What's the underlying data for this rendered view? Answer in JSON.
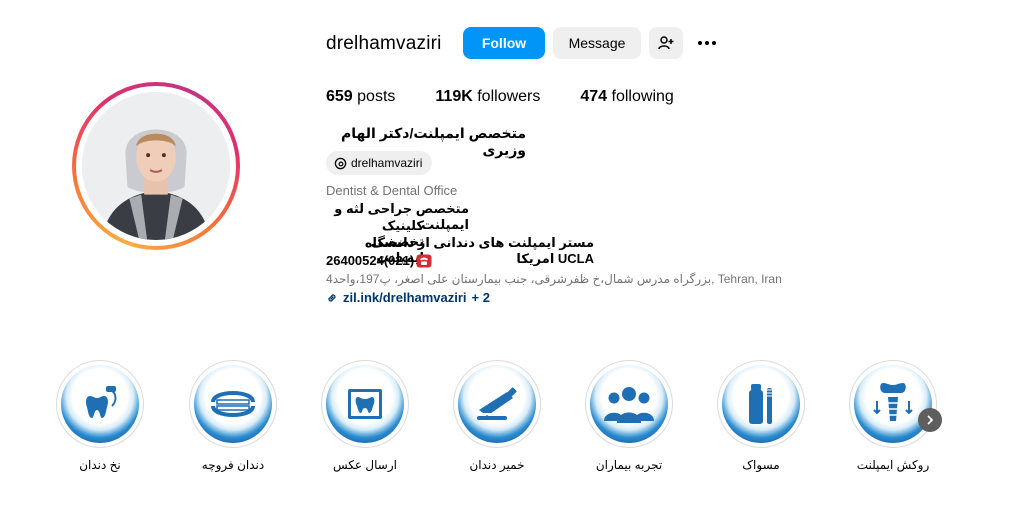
{
  "profile": {
    "username": "drelhamvaziri",
    "follow_label": "Follow",
    "message_label": "Message",
    "posts_count": "659",
    "posts_label": "posts",
    "followers_count": "119K",
    "followers_label": "followers",
    "following_count": "474",
    "following_label": "following",
    "full_name": "متخصص ایمپلنت/دکتر الهام وزیری",
    "threads_handle": "drelhamvaziri",
    "category": "Dentist & Dental Office",
    "bio_lines": [
      "متخصص جراحی لثه و ایمپلنت",
      "کلینیک تخصصی ایمپلنت",
      "مستر ایمپلنت های دندانی از دانشگاه UCLA امریکا",
      "26400524(021)"
    ],
    "address": "بزرگراه مدرس شمال،خ ظفرشرقی، جنب بیمارستان علی اصغر، پ197،واحد4, Tehran, Iran",
    "link_text": "zil.ink/drelhamvaziri",
    "link_extra": "+ 2"
  },
  "highlights": [
    {
      "label": "نخ دندان",
      "icon": "dental-floss-icon"
    },
    {
      "label": "دندان فروچه",
      "icon": "dentures-icon"
    },
    {
      "label": "ارسال عکس",
      "icon": "xray-icon"
    },
    {
      "label": "خمیر دندان",
      "icon": "toothpaste-icon"
    },
    {
      "label": "تجربه بیماران",
      "icon": "patients-icon"
    },
    {
      "label": "مسواک",
      "icon": "toothbrush-icon"
    },
    {
      "label": "روکش ایمپلنت",
      "icon": "implant-crown-icon"
    }
  ],
  "colors": {
    "follow_button": "#0095f6",
    "secondary_button": "#efefef",
    "link": "#00376b",
    "muted_text": "#737373"
  }
}
